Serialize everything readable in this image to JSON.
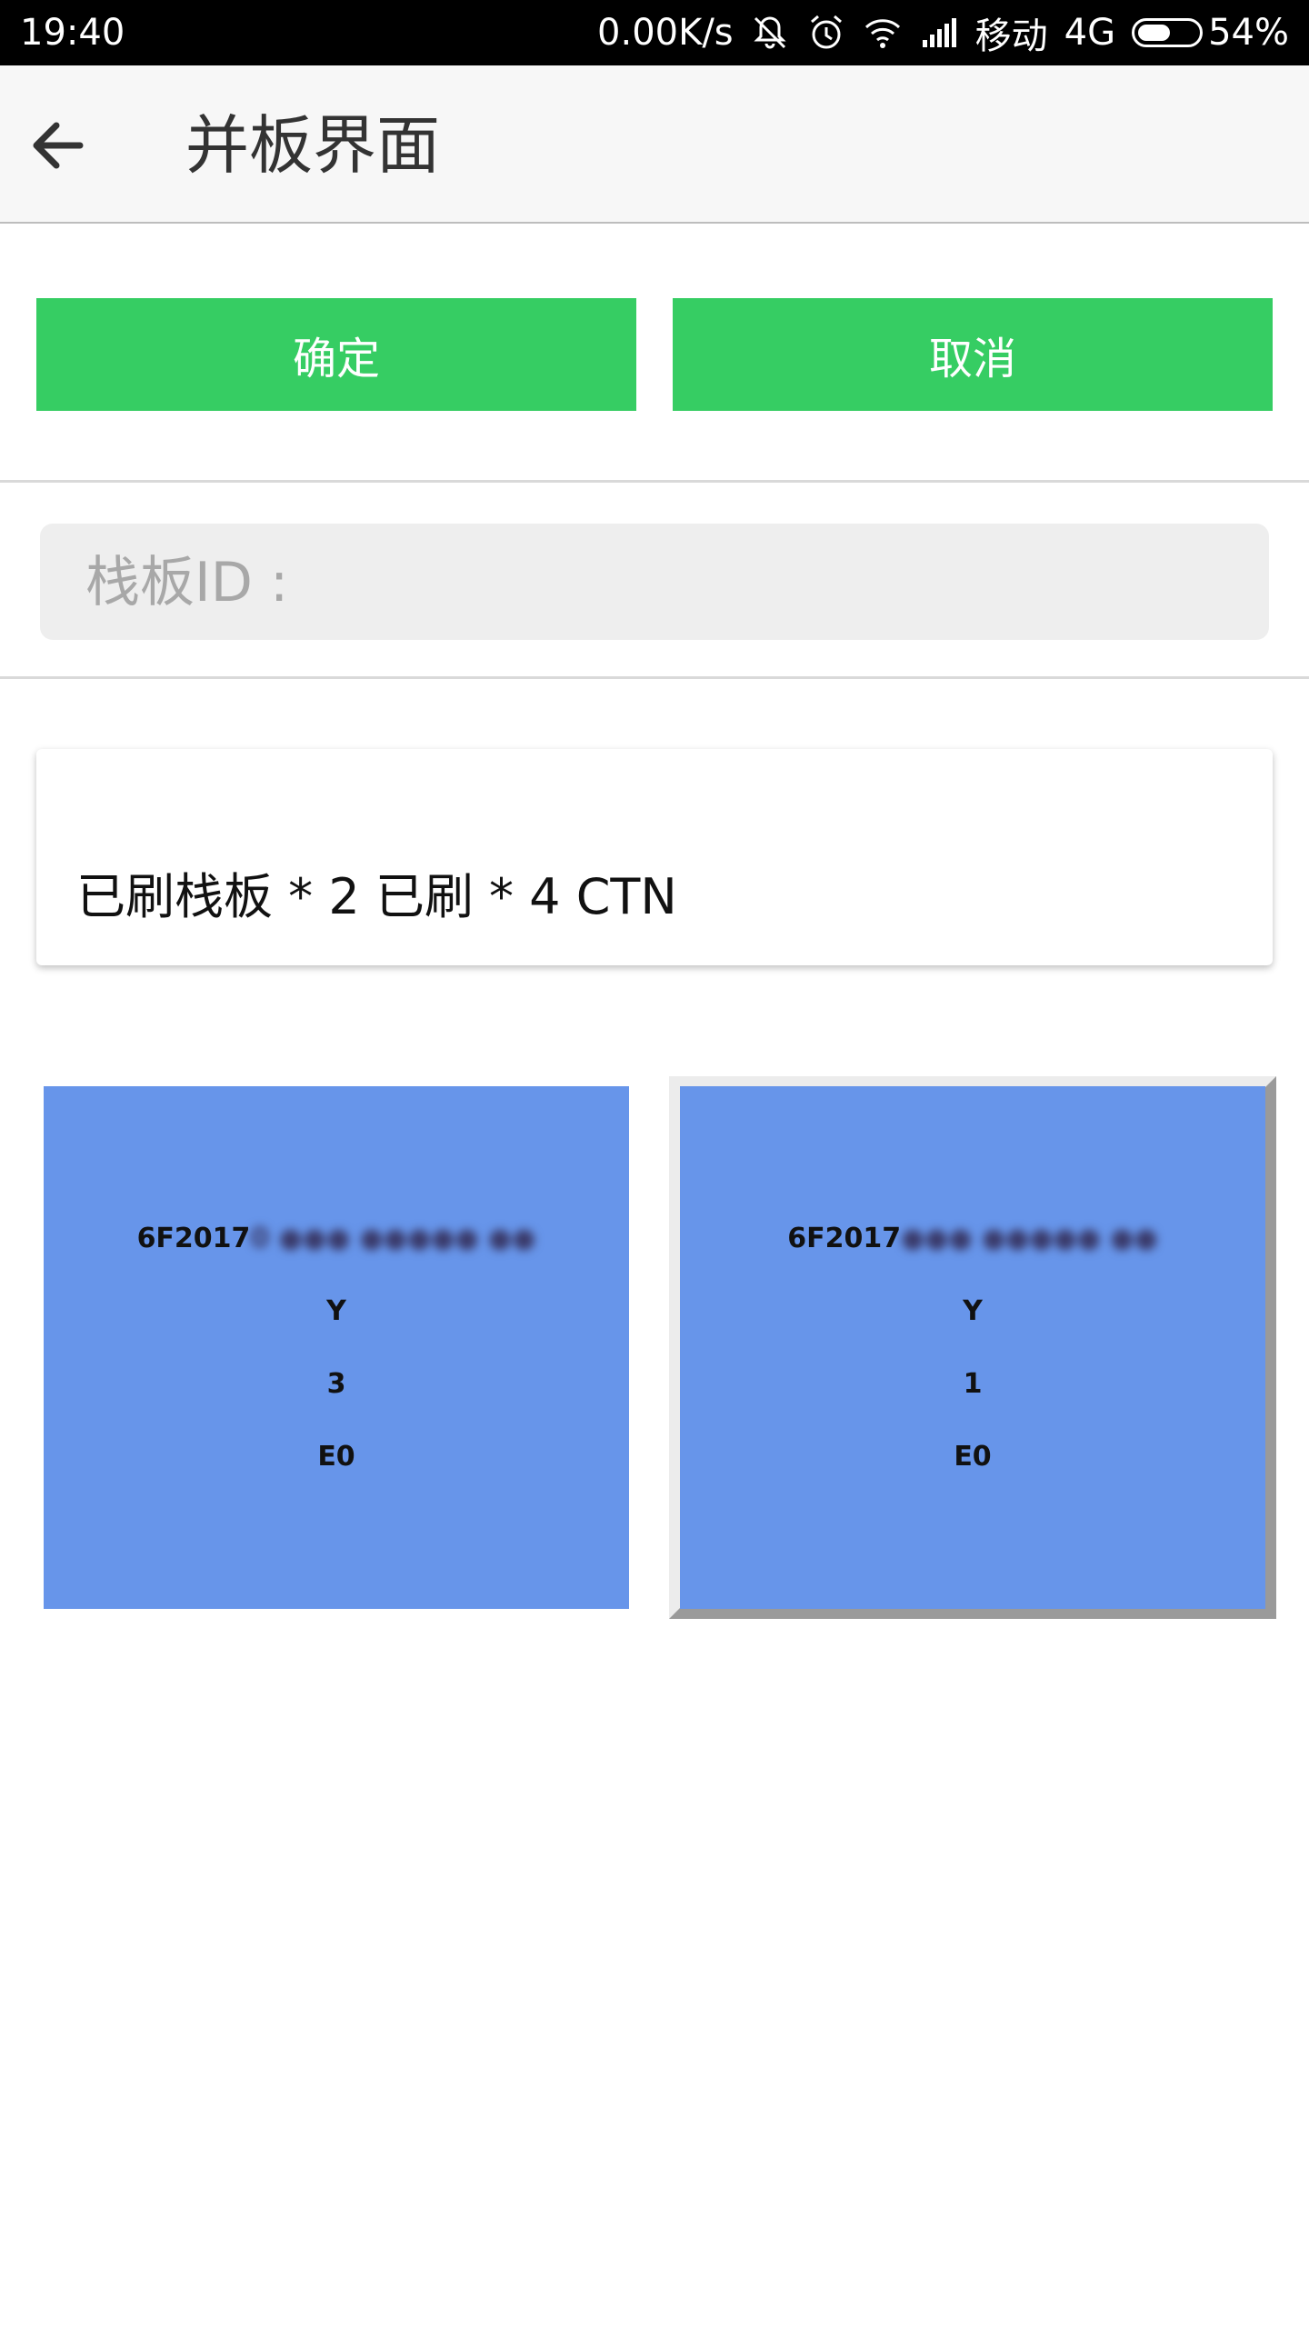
{
  "status_bar": {
    "time": "19:40",
    "speed": "0.00K/s",
    "carrier": "移动",
    "network": "4G",
    "battery": "54%",
    "battery_level": 0.54,
    "icons": [
      "mute-icon",
      "alarm-icon",
      "wifi-icon",
      "signal-icon",
      "battery-icon"
    ]
  },
  "appbar": {
    "title": "并板界面",
    "back_icon": "arrow-back-icon"
  },
  "actions": {
    "confirm_label": "确定",
    "cancel_label": "取消"
  },
  "pallet_input": {
    "placeholder": "栈板ID :",
    "value": ""
  },
  "summary": {
    "text": "已刷栈板 * 2 已刷 * 4 CTN"
  },
  "pallets": [
    {
      "id_visible": "6F2017",
      "id_tail": "0 ●●● ●●●●● ●●",
      "line2": "Y",
      "count": "3",
      "line4": "E0"
    },
    {
      "id_visible": "6F2017",
      "id_tail": " ●●● ●●●●● ●●",
      "line2": "Y",
      "count": "1",
      "line4": "E0"
    }
  ],
  "colors": {
    "button": "#36cd63",
    "tile": "#6795ea",
    "appbar": "#f7f7f7"
  }
}
